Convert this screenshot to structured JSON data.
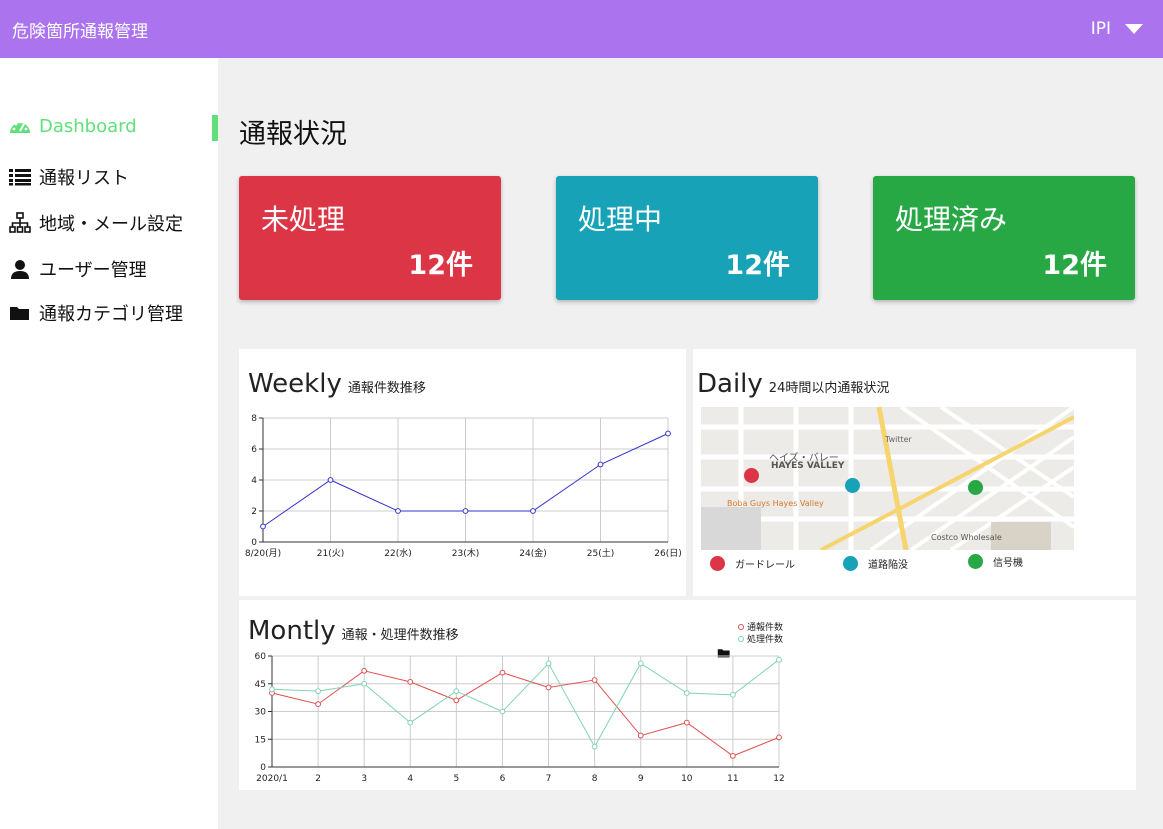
{
  "header": {
    "title": "危険箇所通報管理",
    "user": "IPI"
  },
  "sidebar": {
    "items": [
      {
        "label": "Dashboard",
        "icon": "dashboard-gauge-icon"
      },
      {
        "label": "通報リスト",
        "icon": "list-icon"
      },
      {
        "label": "地域・メール設定",
        "icon": "sitemap-icon"
      },
      {
        "label": "ユーザー管理",
        "icon": "user-icon"
      },
      {
        "label": "通報カテゴリ管理",
        "icon": "folder-icon"
      }
    ]
  },
  "main": {
    "title": "通報状況",
    "cards": [
      {
        "label": "未処理",
        "count": "12件",
        "color": "#dc3545"
      },
      {
        "label": "処理中",
        "count": "12件",
        "color": "#17a2b8"
      },
      {
        "label": "処理済み",
        "count": "12件",
        "color": "#28a745"
      }
    ]
  },
  "weekly": {
    "title": "Weekly",
    "subtitle": "通報件数推移"
  },
  "daily": {
    "title": "Daily",
    "subtitle": "24時間以内通報状況",
    "map_labels": {
      "area": "ヘイズ・バレー",
      "area_en": "HAYES VALLEY",
      "shop": "Boba Guys Hayes Valley",
      "store": "Costco Wholesale",
      "place": "Twitter"
    },
    "legend": [
      {
        "label": "ガードレール",
        "color": "#dc3545"
      },
      {
        "label": "道路陥没",
        "color": "#17a2b8"
      },
      {
        "label": "信号機",
        "color": "#28a745"
      }
    ]
  },
  "monthly": {
    "title": "Montly",
    "subtitle": "通報・処理件数推移"
  },
  "chart_data": [
    {
      "type": "line",
      "categories": [
        "8/20(月)",
        "21(火)",
        "22(水)",
        "23(木)",
        "24(金)",
        "25(土)",
        "26(日)"
      ],
      "series": [
        {
          "values": [
            1,
            4,
            2,
            2,
            2,
            5,
            7
          ],
          "color": "#3333cc"
        }
      ],
      "ylim": [
        0,
        8
      ],
      "yticks": [
        0,
        2,
        4,
        6,
        8
      ],
      "grid": true
    },
    {
      "type": "line",
      "categories": [
        "2020/1",
        "2",
        "3",
        "4",
        "5",
        "6",
        "7",
        "8",
        "9",
        "10",
        "11",
        "12"
      ],
      "series": [
        {
          "name": "通報件数",
          "values": [
            40,
            34,
            52,
            46,
            36,
            51,
            43,
            47,
            17,
            24,
            6,
            16
          ],
          "color": "#e05050"
        },
        {
          "name": "処理件数",
          "values": [
            42,
            41,
            45,
            24,
            41,
            30,
            56,
            11,
            56,
            40,
            39,
            58
          ],
          "color": "#7fd3b4"
        }
      ],
      "ylim": [
        0,
        60
      ],
      "yticks": [
        0,
        15,
        30,
        45,
        60
      ],
      "grid": true,
      "legend_position": "top-right"
    }
  ]
}
